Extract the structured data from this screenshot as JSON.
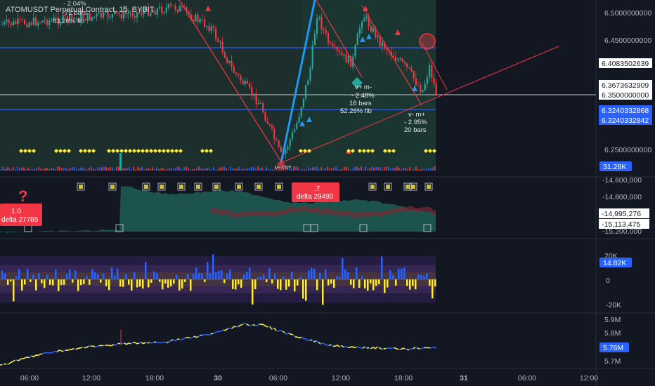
{
  "header": {
    "symbol_line": "ATOMUSDT Perpetual Contract, 15, BYBIT",
    "fib_pct": "- 2.04%",
    "fib_bars": "72 bars",
    "fib_ratio": "63.26% fib"
  },
  "annotations": {
    "mid_label": "v+ m-",
    "mid_pct": "- 2.48%",
    "mid_bars": "16 bars",
    "mid_fib": "52.26% fib",
    "right_label": "v- m+",
    "right_pct": "- 2.95%",
    "right_bars": "20 bars",
    "bottom_label": "v- m+"
  },
  "price_axis": {
    "ticks": [
      "6.5000000000",
      "6.4500000000",
      "6.2500000000"
    ],
    "tags": [
      {
        "text": "6.4083502639",
        "bg": "#ffffff",
        "fg": "#131722",
        "price": 6.40835
      },
      {
        "text": "6.3673632909",
        "bg": "#ffffff",
        "fg": "#131722",
        "price": 6.36736
      },
      {
        "text": "6.3500000000",
        "bg": "#ffffff",
        "fg": "#131722",
        "price": 6.35
      },
      {
        "text": "6.3240332868",
        "bg": "#2962ff",
        "fg": "#ffffff",
        "price": 6.32403
      },
      {
        "text": "6.3240332842",
        "bg": "#2962ff",
        "fg": "#ffffff",
        "price": 6.32402
      }
    ],
    "volume_tag": "31.28K"
  },
  "cvd_panel": {
    "ticks": [
      "-14,600,000",
      "-14,800,000",
      "-15,200,000"
    ],
    "tag_a": "-14,995,276",
    "tag_b": "-15,113,475",
    "left_box": {
      "line1": "1.0",
      "line2": "delta 27785"
    },
    "mid_box": {
      "line1": ".7",
      "line2": "delta 29490"
    },
    "question": "?"
  },
  "delta_panel": {
    "ticks": [
      "20K",
      "0",
      "-20K"
    ],
    "tag": "14.82K"
  },
  "oi_panel": {
    "ticks": [
      "5.9M",
      "5.8M",
      "5.7M"
    ],
    "tag": "5.76M"
  },
  "time_axis": {
    "labels": [
      "06:00",
      "12:00",
      "18:00",
      "30",
      "06:00",
      "12:00",
      "18:00",
      "31",
      "06:00",
      "12:00"
    ]
  },
  "colors": {
    "background": "#131722",
    "blue_line": "#2962ff",
    "red_line": "#f23645",
    "yellow": "#ffeb3b",
    "teal": "#26a69a"
  }
}
